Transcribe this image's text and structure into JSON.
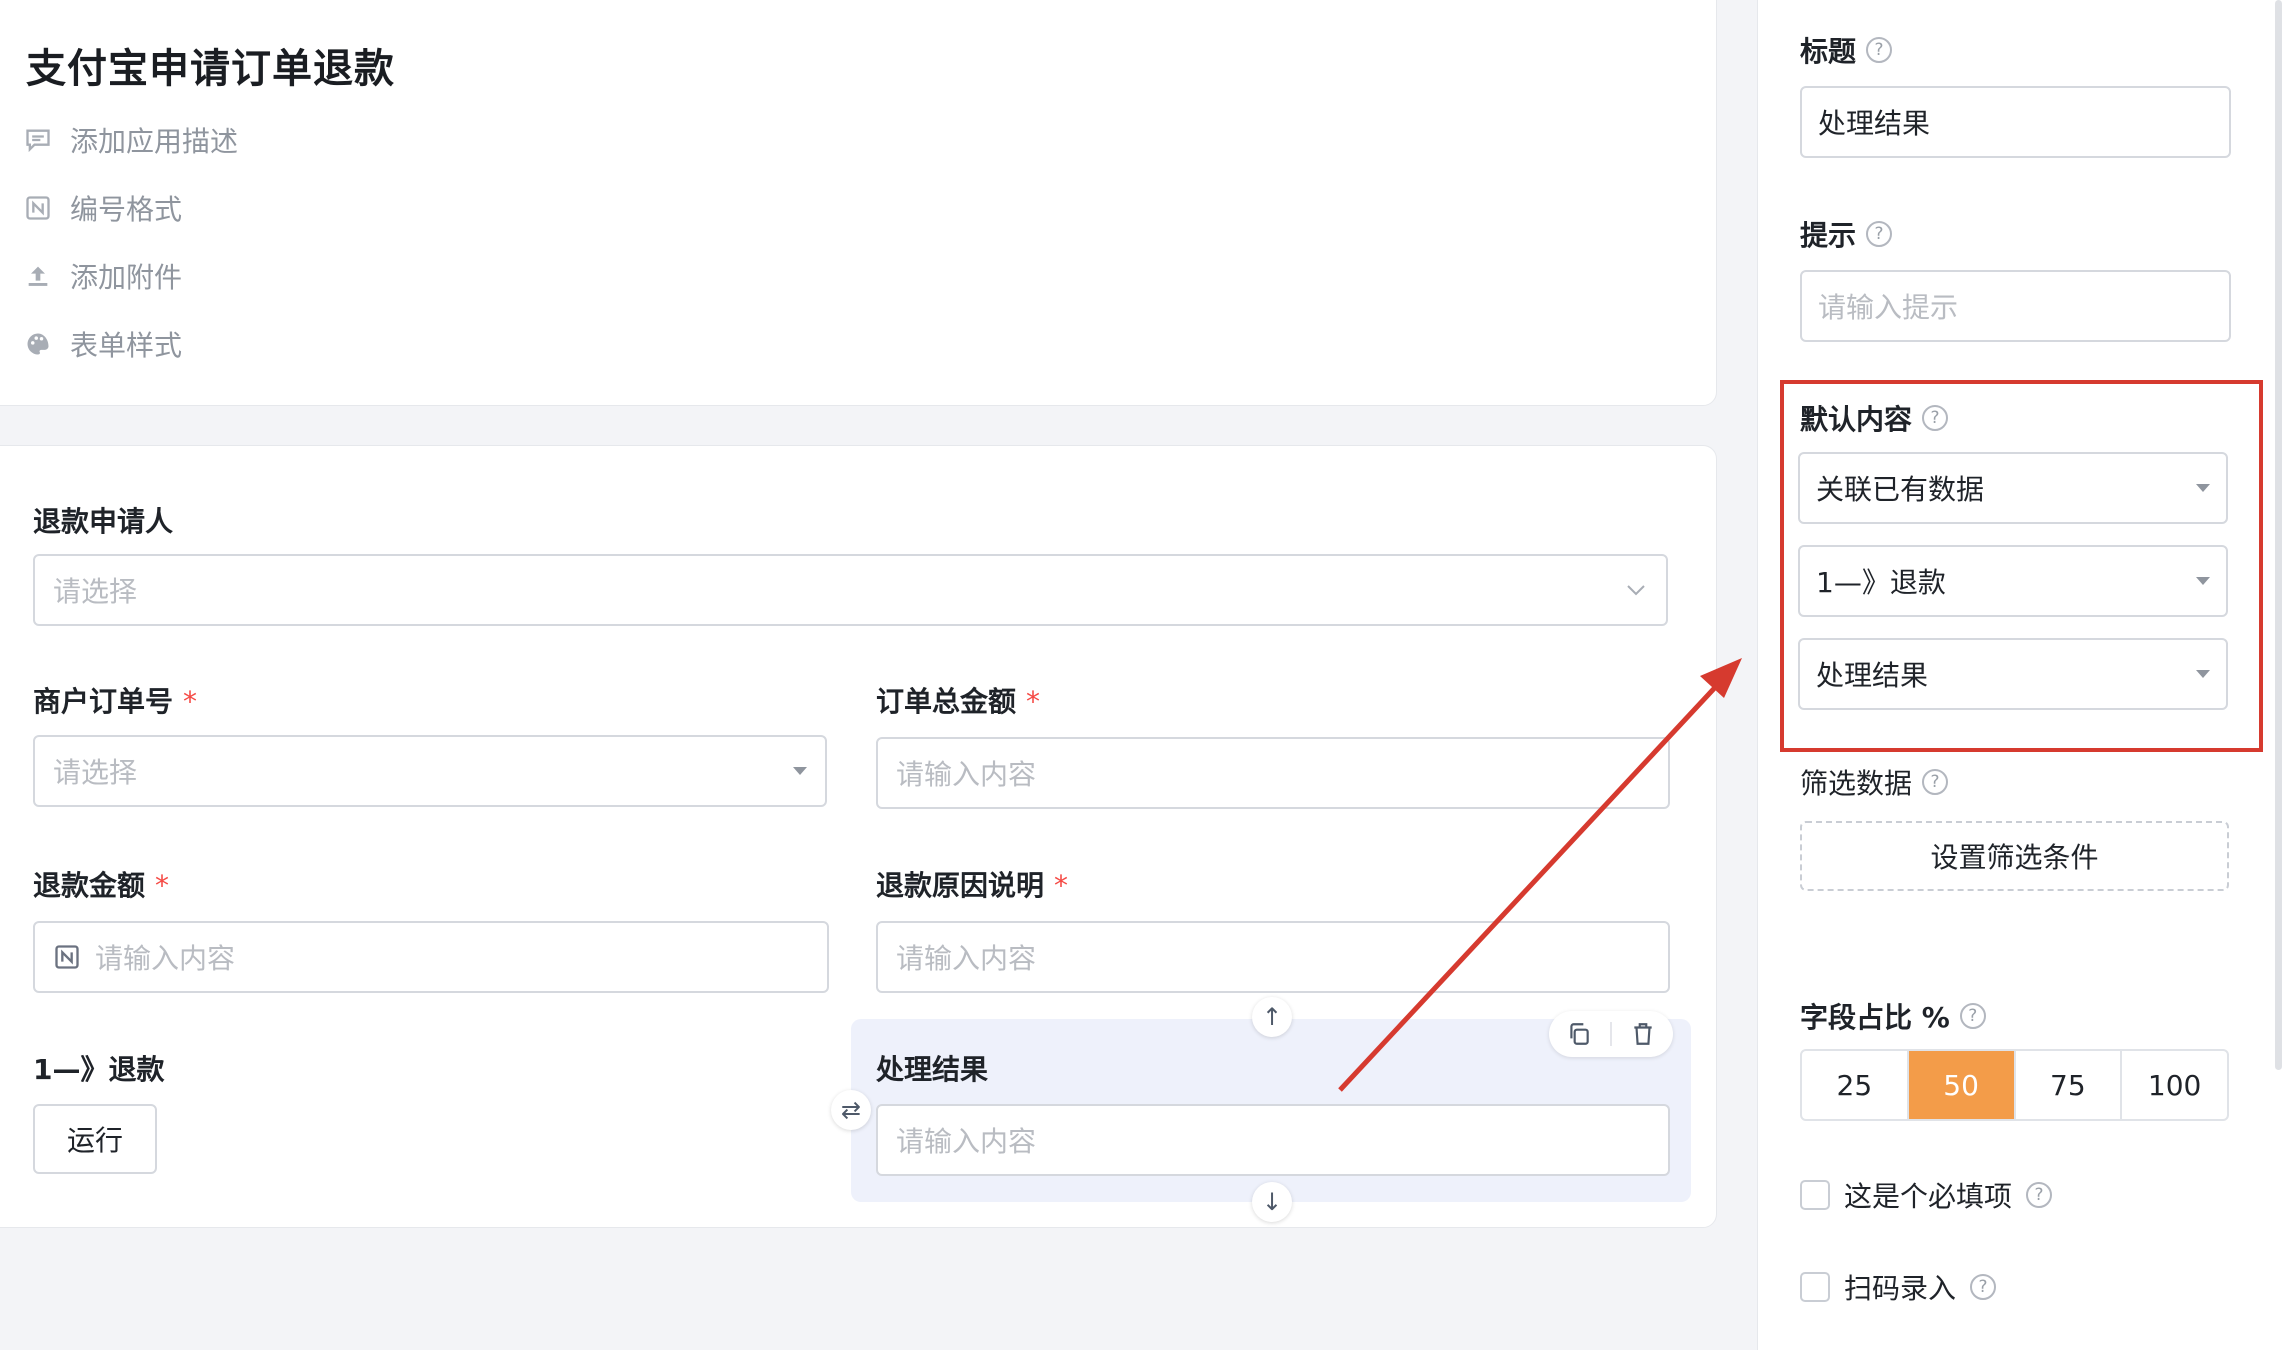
{
  "app": {
    "title": "支付宝申请订单退款",
    "meta": [
      "添加应用描述",
      "编号格式",
      "添加附件",
      "表单样式"
    ]
  },
  "form": {
    "applicant": {
      "label": "退款申请人",
      "placeholder": "请选择"
    },
    "order_no": {
      "label": "商户订单号",
      "placeholder": "请选择",
      "required": "*"
    },
    "order_total": {
      "label": "订单总金额",
      "placeholder": "请输入内容",
      "required": "*"
    },
    "refund_amount": {
      "label": "退款金额",
      "placeholder": "请输入内容",
      "required": "*"
    },
    "refund_reason": {
      "label": "退款原因说明",
      "placeholder": "请输入内容",
      "required": "*"
    },
    "refund_step": {
      "label": "1—》退款",
      "button": "运行"
    },
    "result": {
      "label": "处理结果",
      "placeholder": "请输入内容"
    }
  },
  "panel": {
    "title_label": "标题",
    "title_value": "处理结果",
    "hint_label": "提示",
    "hint_placeholder": "请输入提示",
    "default_label": "默认内容",
    "default_selects": [
      "关联已有数据",
      "1—》退款",
      "处理结果"
    ],
    "filter_label": "筛选数据",
    "filter_button": "设置筛选条件",
    "ratio_label": "字段占比 %",
    "ratio_options": [
      "25",
      "50",
      "75",
      "100"
    ],
    "ratio_selected": "50",
    "required_label": "这是个必填项",
    "scan_label": "扫码录入"
  },
  "colors": {
    "accent": "#f39c49",
    "annotation": "#d63a2f",
    "required": "#f54a45",
    "selected_block": "#eef1fb"
  },
  "icons": [
    "comment-icon",
    "number-format-icon",
    "upload-icon",
    "palette-icon",
    "chevron-down-icon",
    "caret-down-icon",
    "help-icon",
    "copy-icon",
    "delete-icon",
    "arrow-up-icon",
    "arrow-down-icon",
    "swap-icon"
  ]
}
